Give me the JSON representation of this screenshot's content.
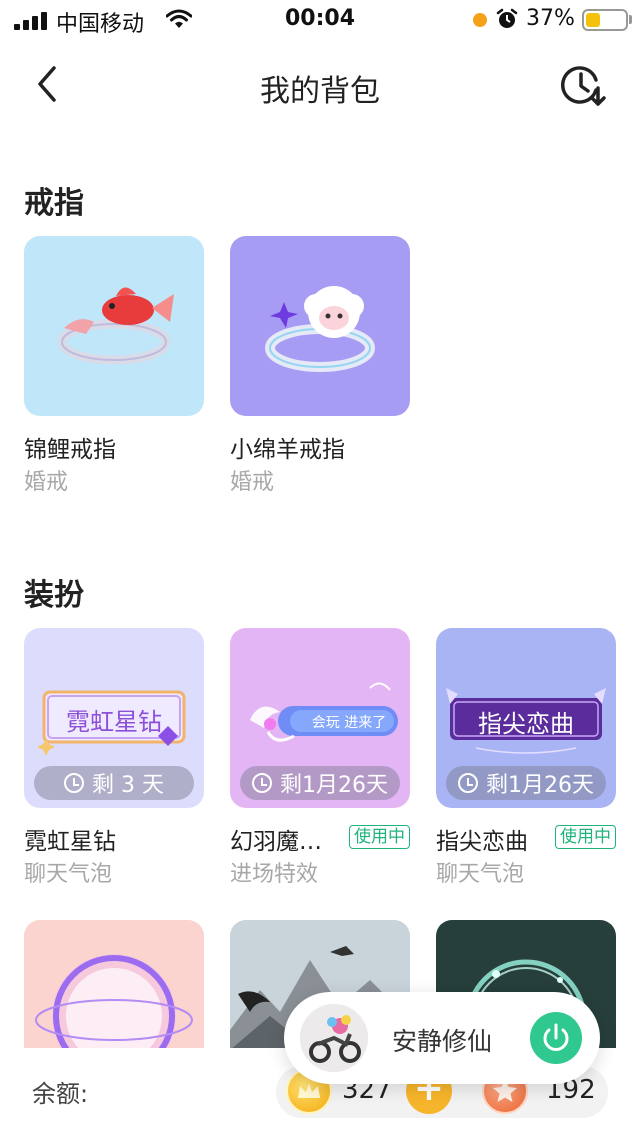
{
  "status_bar": {
    "carrier": "中国移动",
    "time": "00:04",
    "battery_percent": "37%",
    "battery_level": 0.37,
    "icons": [
      "signal-icon",
      "wifi-icon",
      "alarm-icon",
      "battery-icon"
    ]
  },
  "nav": {
    "title": "我的背包",
    "icons": [
      "back-icon",
      "history-icon"
    ]
  },
  "sections": {
    "rings": {
      "title": "戒指",
      "items": [
        {
          "name": "锦鲤戒指",
          "type": "婚戒",
          "color": "#bfe6f9",
          "icon": "koi-ring-icon"
        },
        {
          "name": "小绵羊戒指",
          "type": "婚戒",
          "color": "#a79cf3",
          "icon": "sheep-ring-icon"
        }
      ]
    },
    "outfits": {
      "title": "装扮",
      "items": [
        {
          "name": "霓虹星钻",
          "type": "聊天气泡",
          "timer": "剩 3 天",
          "in_use": "",
          "color": "#dcdcfc",
          "art_text": "霓虹星钻",
          "icon": "neon-frame-icon"
        },
        {
          "name": "幻羽魔…",
          "type": "进场特效",
          "timer": "剩1月26天",
          "in_use": "使用中",
          "color": "#e4b5f5",
          "art_text": "会玩  进来了",
          "icon": "wing-effect-icon"
        },
        {
          "name": "指尖恋曲",
          "type": "聊天气泡",
          "timer": "剩1月26天",
          "in_use": "使用中",
          "color": "#a9b4f5",
          "art_text": "指尖恋曲",
          "icon": "purple-frame-icon"
        }
      ],
      "more_thumbs": [
        {
          "color": "#fbd3cf",
          "icon": "orb-frame-icon"
        },
        {
          "color": "#c9d3da",
          "icon": "crane-landscape-icon"
        },
        {
          "color": "#263f3b",
          "icon": "glow-ring-icon"
        }
      ]
    }
  },
  "bottom_bar": {
    "balance_label": "余额:",
    "gold_value": "327",
    "star_value": "192",
    "plus_label": "+"
  },
  "player": {
    "name": "安静修仙"
  },
  "colors": {
    "accent_green": "#1fb57a",
    "gold": "#f7b52b",
    "star": "#e8622e"
  }
}
